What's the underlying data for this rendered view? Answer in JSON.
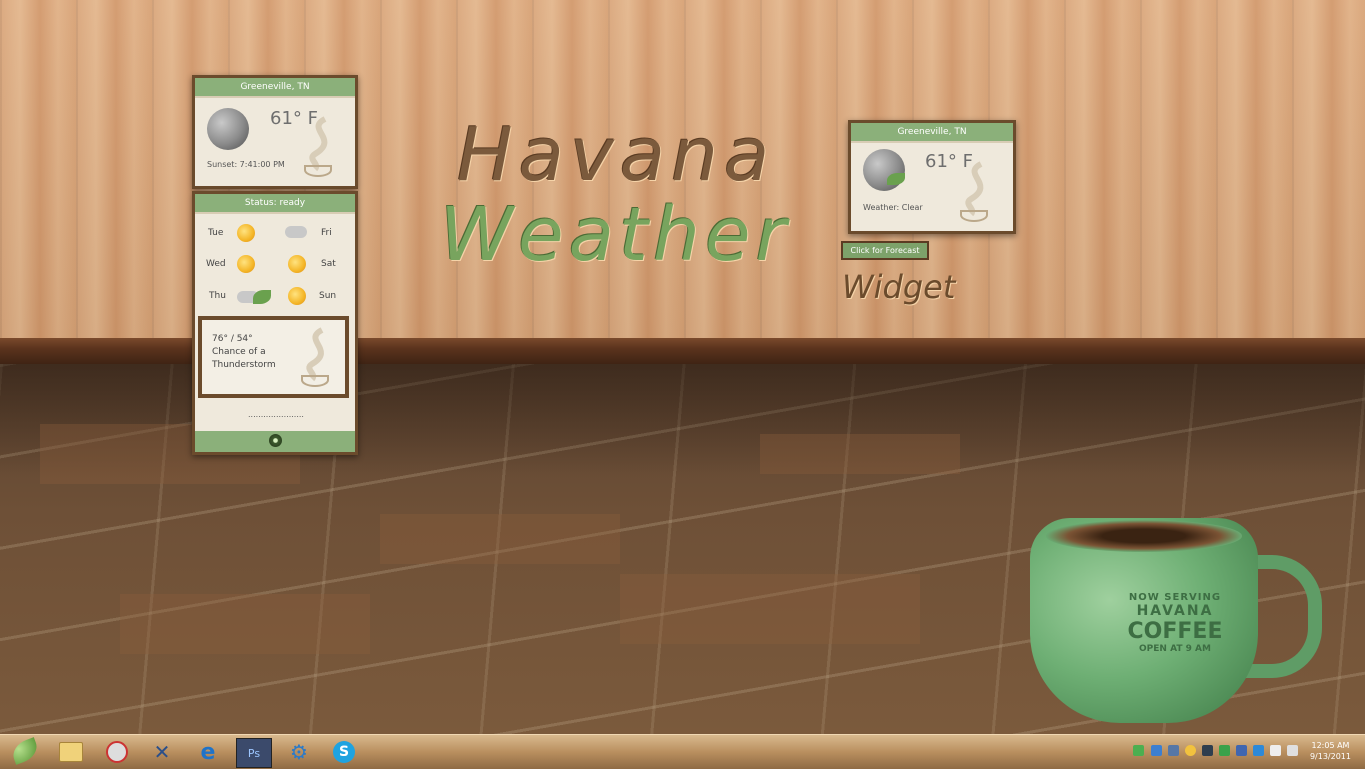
{
  "hero": {
    "line1": "Havana",
    "line2": "Weather",
    "line3": "Widget"
  },
  "small_widget": {
    "location": "Greeneville, TN",
    "temp": "61° F",
    "status": "Weather: Clear",
    "forecast_button": "Click for Forecast"
  },
  "large_widget": {
    "location": "Greeneville, TN",
    "temp": "61° F",
    "sunset": "Sunset: 7:41:00 PM",
    "status": "Status: ready",
    "days": [
      {
        "label": "Tue",
        "icon": "partly-cloudy-icon"
      },
      {
        "label": "Wed",
        "icon": "partly-cloudy-icon"
      },
      {
        "label": "Thu",
        "icon": "thunderstorm-icon"
      },
      {
        "label": "Fri",
        "icon": "thunderstorm-icon"
      },
      {
        "label": "Sat",
        "icon": "partly-cloudy-icon"
      },
      {
        "label": "Sun",
        "icon": "partly-cloudy-icon"
      }
    ],
    "detail_temp": "76° / 54°",
    "detail_line1": "Chance of a",
    "detail_line2": "Thunderstorm",
    "dots": "......................"
  },
  "mug": {
    "line1": "NOW SERVING",
    "line2": "HAVANA",
    "line3": "COFFEE",
    "line4": "OPEN AT 9 AM"
  },
  "taskbar": {
    "apps": [
      "folder-icon",
      "paint-icon",
      "tools-icon",
      "internet-explorer-icon",
      "photoshop-icon",
      "settings-icon",
      "skype-icon"
    ],
    "ps_label": "Ps",
    "clock_time": "12:05 AM",
    "clock_date": "9/13/2011"
  },
  "colors": {
    "accent": "#8bb07a",
    "frame": "#6b4b2c",
    "wall": "#dcaa7e"
  }
}
